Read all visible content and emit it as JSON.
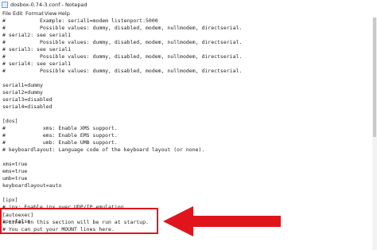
{
  "window": {
    "title": "dosbox-0.74-3.conf - Notepad"
  },
  "menu": [
    "File",
    "Edit",
    "Format",
    "View",
    "Help"
  ],
  "colors": {
    "highlight": "#e0151c",
    "text": "#1e1e1e"
  },
  "icons": {
    "app": "notepad-icon",
    "arrow": "red-arrow-pointing-left"
  },
  "lines": [
    "#           Example: serial1=modem listenport:5000",
    "#           Possible values: dummy, disabled, modem, nullmodem, directserial.",
    "# serial2: see serial1",
    "#           Possible values: dummy, disabled, modem, nullmodem, directserial.",
    "# serial3: see serial1",
    "#           Possible values: dummy, disabled, modem, nullmodem, directserial.",
    "# serial4: see serial1",
    "#           Possible values: dummy, disabled, modem, nullmodem, directserial.",
    "",
    "serial1=dummy",
    "serial2=dummy",
    "serial3=disabled",
    "serial4=disabled",
    "",
    "[dos]",
    "#            xms: Enable XMS support.",
    "#            ems: Enable EMS support.",
    "#            umb: Enable UMB support.",
    "# keyboardlayout: Language code of the keyboard layout (or none).",
    "",
    "xms=true",
    "ems=true",
    "umb=true",
    "keyboardlayout=auto",
    "",
    "[ipx]",
    "# ipx: Enable ipx over UDP/IP emulation.",
    "",
    "ipx=false",
    "",
    "[autoexec]",
    "# Lines in this section will be run at startup.",
    "# You can put your MOUNT lines here."
  ]
}
